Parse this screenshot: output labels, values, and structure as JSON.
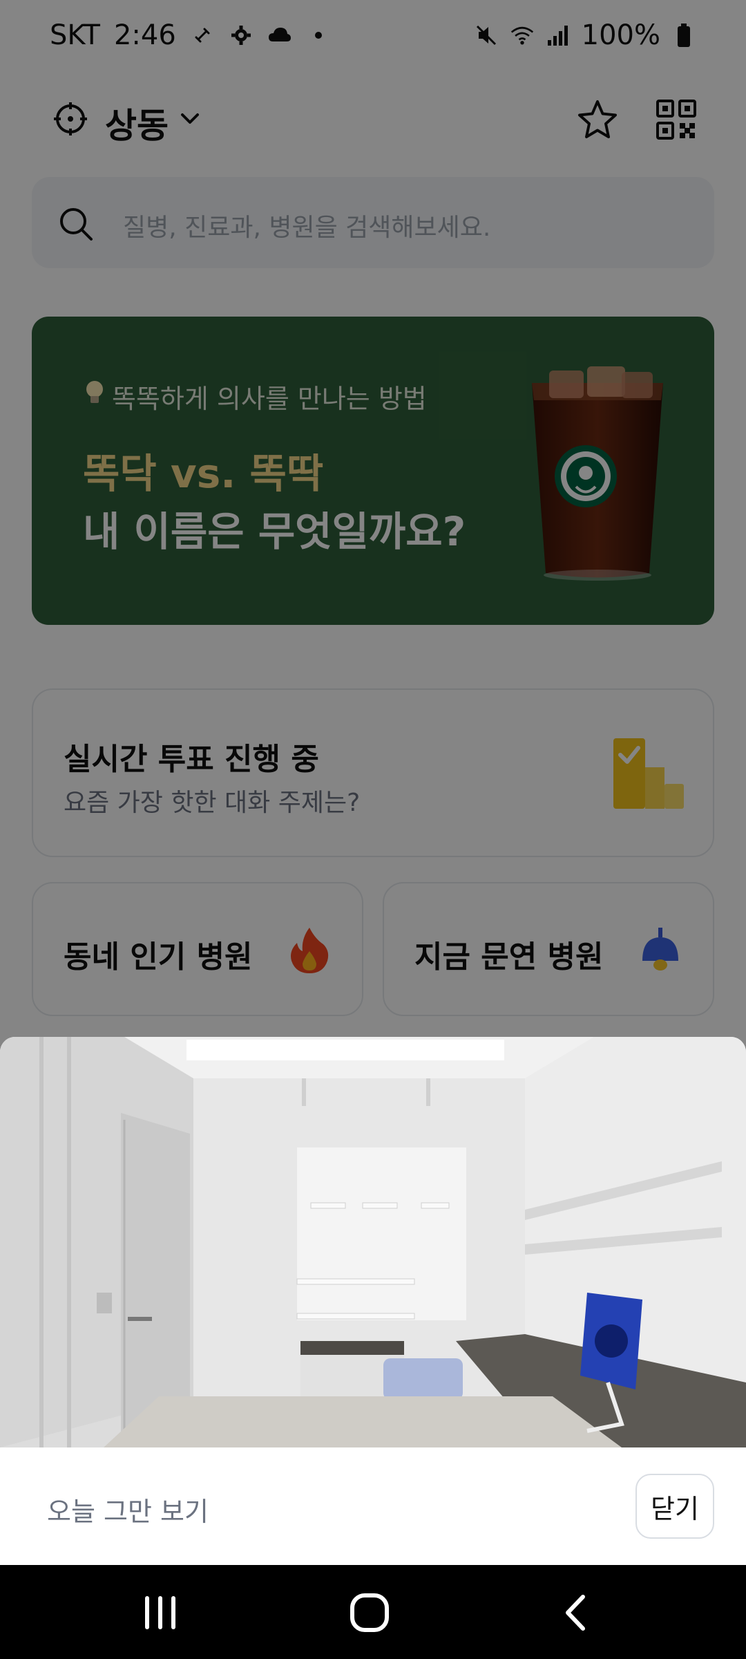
{
  "status_bar": {
    "carrier": "SKT",
    "time": "2:46",
    "battery": "100%",
    "icons": [
      "link-icon",
      "settings-icon",
      "cloud-icon",
      "dot-icon",
      "mute-icon",
      "wifi-icon",
      "signal-icon",
      "battery-icon"
    ]
  },
  "header": {
    "location": "상동",
    "icons": [
      "location-target-icon",
      "chevron-down-icon",
      "star-icon",
      "qr-code-icon"
    ]
  },
  "search": {
    "placeholder": "질병, 진료과, 병원을 검색해보세요."
  },
  "banner": {
    "kicker": "똑똑하게 의사를 만나는 방법",
    "title_line1": "똑닥 vs. 똑딱",
    "title_line2": "내 이름은 무엇일까요?",
    "background_color": "#2f5f3a",
    "accent_color": "#f3d78a"
  },
  "vote_card": {
    "title": "실시간 투표 진행 중",
    "subtitle": "요즘 가장 핫한 대화 주제는?"
  },
  "quick_cards": [
    {
      "label": "동네 인기 병원",
      "icon": "fire-icon"
    },
    {
      "label": "지금 문연 병원",
      "icon": "lamp-icon"
    }
  ],
  "popup": {
    "dont_show_today": "오늘 그만 보기",
    "close": "닫기"
  },
  "nav_bar": {
    "icons": [
      "recent-apps-icon",
      "home-icon",
      "back-icon"
    ]
  }
}
